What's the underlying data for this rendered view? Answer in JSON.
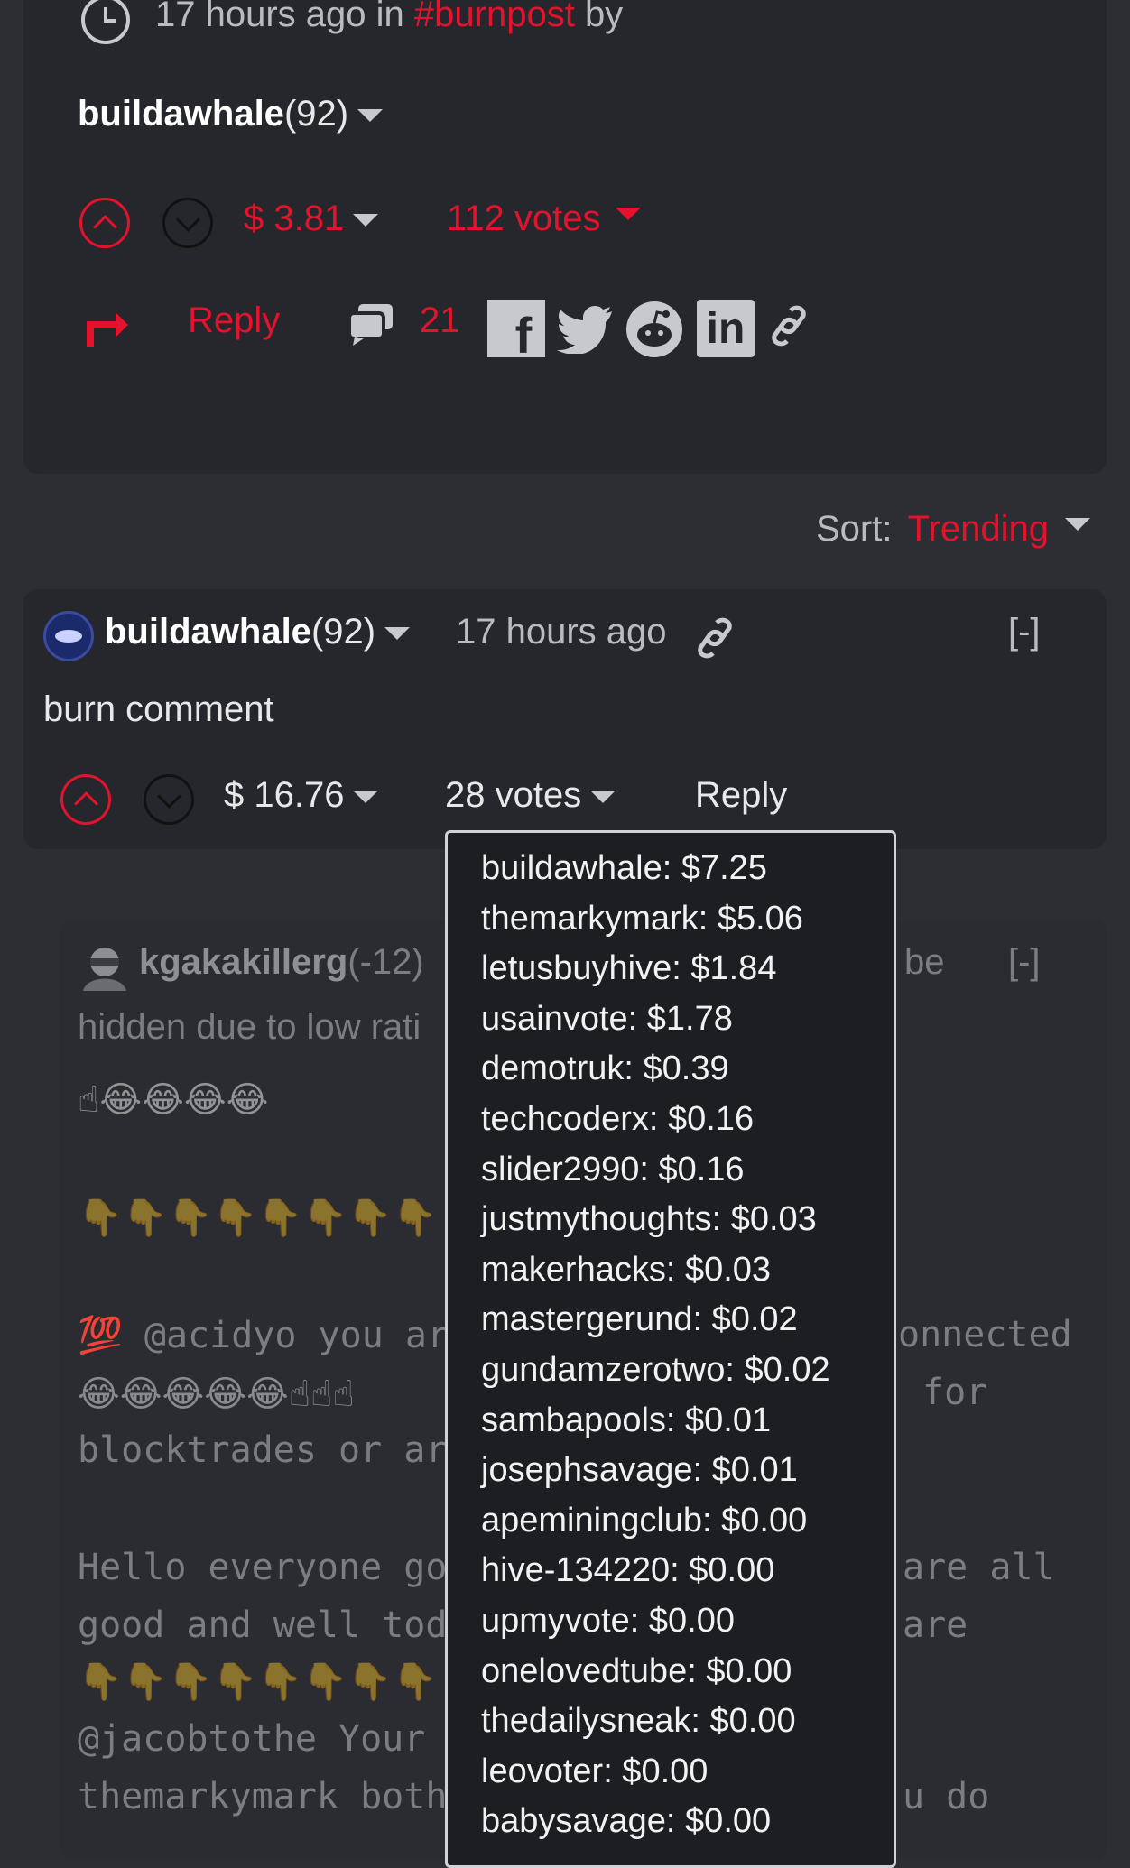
{
  "post": {
    "time_prefix": "17 hours ago in",
    "community": "#burnpost",
    "time_suffix": "by",
    "author": "buildawhale",
    "reputation": "(92)",
    "payout": "$ 3.81",
    "votes": "112 votes",
    "reply_label": "Reply",
    "comment_count": "21"
  },
  "sort": {
    "label": "Sort:",
    "value": "Trending"
  },
  "comment": {
    "author": "buildawhale",
    "reputation": "(92)",
    "time": "17 hours ago",
    "collapse": "[-]",
    "body": "burn comment",
    "payout": "$ 16.76",
    "votes": "28 votes",
    "reply_label": "Reply"
  },
  "reply": {
    "author": "kgakakillerg",
    "reputation": "(-12)",
    "collapse": "[-]",
    "hidden_text": "hidden due to low rati",
    "partial_be": "be",
    "emoji_line1": "☝😂😂😂😂",
    "emoji_line2": "👇👇👇👇👇👇👇👇",
    "line_100": "💯 @acidyo you ar",
    "line_connected": "onnected",
    "emoji_line3": "😂😂😂😂😂☝☝☝",
    "line_for": "for",
    "line_blocktrades": "blocktrades or ar",
    "line_hello": "Hello everyone go",
    "line_are_all": "are all",
    "line_good": "good and well tod",
    "line_are": "are",
    "emoji_line4": "👇👇👇👇👇👇👇👇",
    "line_jacob": "@jacobtothe Your",
    "line_markymark": "themarkymark both",
    "line_u_do": "u do"
  },
  "voters": [
    "buildawhale: $7.25",
    "themarkymark: $5.06",
    "letusbuyhive: $1.84",
    "usainvote: $1.78",
    "demotruk: $0.39",
    "techcoderx: $0.16",
    "slider2990: $0.16",
    "justmythoughts: $0.03",
    "makerhacks: $0.03",
    "mastergerund: $0.02",
    "gundamzerotwo: $0.02",
    "sambapools: $0.01",
    "josephsavage: $0.01",
    "apeminingclub: $0.00",
    "hive-134220: $0.00",
    "upmyvote: $0.00",
    "onelovedtube: $0.00",
    "thedailysneak: $0.00",
    "leovoter: $0.00",
    "babysavage: $0.00"
  ],
  "colors": {
    "accent": "#e3132d",
    "background": "#2c2e33",
    "card": "#25272c"
  }
}
